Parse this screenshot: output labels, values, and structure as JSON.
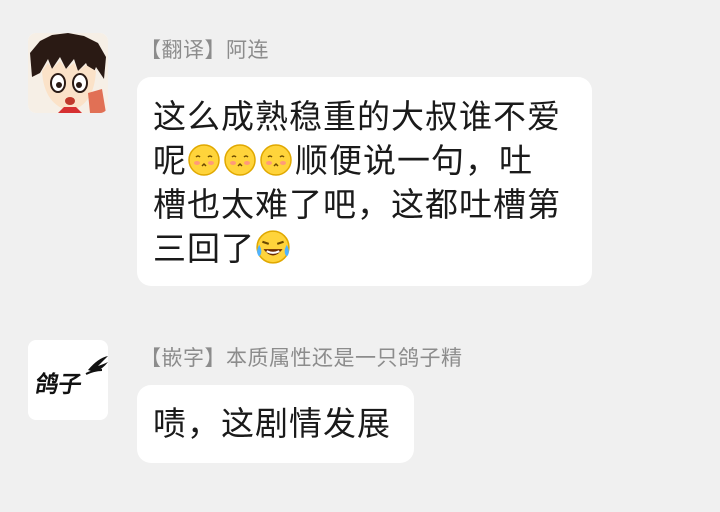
{
  "messages": [
    {
      "sender": "【翻译】阿连",
      "avatar_icon": "anime-boy-avatar-icon",
      "lines": [
        {
          "text": "这么成熟稳重的大叔谁不爱"
        },
        {
          "prefix": "呢",
          "emojis": [
            "blush-emoji-icon",
            "blush-emoji-icon",
            "blush-emoji-icon"
          ],
          "suffix": "顺便说一句，吐"
        },
        {
          "text": "槽也太难了吧，这都吐槽第"
        },
        {
          "prefix": "三回了",
          "emojis": [
            "laugh-cry-emoji-icon"
          ],
          "suffix": ""
        }
      ]
    },
    {
      "sender": "【嵌字】本质属性还是一只鸽子精",
      "avatar_text": "鸽子",
      "avatar_icon": "wing-icon",
      "lines": [
        {
          "text": "啧，这剧情发展"
        }
      ]
    }
  ],
  "colors": {
    "background": "#f0f0f0",
    "bubble": "#ffffff",
    "sender_text": "#8c8c8c",
    "message_text": "#1a1a1a",
    "emoji_face": "#ffd43b"
  }
}
